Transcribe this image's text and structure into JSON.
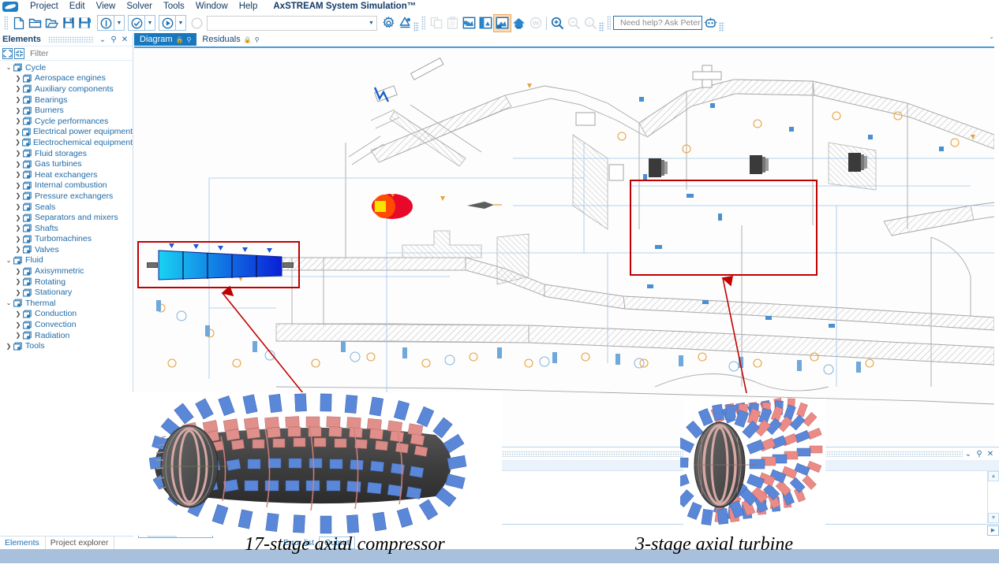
{
  "window": {
    "app_title": "AxSTREAM System Simulation™",
    "logo_icon": "axstream-logo-icon"
  },
  "menu": {
    "items": [
      "Project",
      "Edit",
      "View",
      "Solver",
      "Tools",
      "Window",
      "Help"
    ]
  },
  "toolbar": {
    "groups": [
      {
        "name": "file",
        "buttons": [
          {
            "icon": "new-document-icon",
            "label": "New",
            "state": "enabled"
          },
          {
            "icon": "open-folder-icon",
            "label": "Open",
            "state": "enabled"
          },
          {
            "icon": "open-recent-icon",
            "label": "Open recent",
            "state": "enabled"
          },
          {
            "icon": "save-icon",
            "label": "Save",
            "state": "enabled"
          },
          {
            "icon": "save-as-icon",
            "label": "Save as",
            "state": "enabled"
          }
        ]
      },
      {
        "name": "solver",
        "buttons": [
          {
            "icon": "info-circle-icon",
            "label": "Info",
            "state": "enabled",
            "split": true
          },
          {
            "icon": "check-circle-icon",
            "label": "Validate",
            "state": "enabled",
            "split": true
          },
          {
            "icon": "run-play-icon",
            "label": "Run",
            "state": "enabled",
            "split": true
          },
          {
            "icon": "stop-circle-icon",
            "label": "Stop",
            "state": "disabled"
          }
        ]
      },
      {
        "name": "settings",
        "buttons": [
          {
            "icon": "gear-settings-icon",
            "label": "Settings",
            "state": "enabled"
          },
          {
            "icon": "units-icon",
            "label": "Units",
            "state": "enabled"
          }
        ]
      },
      {
        "name": "clipboard",
        "buttons": [
          {
            "icon": "copy-icon",
            "label": "Copy",
            "state": "disabled"
          },
          {
            "icon": "paste-icon",
            "label": "Paste",
            "state": "disabled"
          },
          {
            "icon": "fit-diagram-icon",
            "label": "Fit diagram",
            "state": "enabled"
          },
          {
            "icon": "align-left-icon",
            "label": "Align",
            "state": "enabled"
          },
          {
            "icon": "background-image-icon",
            "label": "Background image",
            "state": "active"
          },
          {
            "icon": "home-view-icon",
            "label": "Home view",
            "state": "enabled"
          },
          {
            "icon": "watermark-icon",
            "label": "Watermark",
            "state": "disabled"
          }
        ]
      },
      {
        "name": "zoom",
        "buttons": [
          {
            "icon": "zoom-in-icon",
            "label": "Zoom in",
            "state": "enabled"
          },
          {
            "icon": "zoom-out-icon",
            "label": "Zoom out",
            "state": "disabled"
          },
          {
            "icon": "zoom-100-icon",
            "label": "Zoom 100%",
            "state": "disabled"
          }
        ]
      }
    ],
    "combo_value": "",
    "ask_peter": {
      "placeholder": "Need help? Ask Peter",
      "icon": "assistant-bot-icon"
    }
  },
  "elements_panel": {
    "title": "Elements",
    "header_icons": [
      "chevron-down-icon",
      "pin-icon",
      "close-icon"
    ],
    "expand_all_icon": "expand-all-icon",
    "collapse_all_icon": "collapse-all-icon",
    "filter_placeholder": "Filter",
    "search_icon": "search-icon",
    "tree": [
      {
        "label": "Cycle",
        "level": 1,
        "expanded": true
      },
      {
        "label": "Aerospace engines",
        "level": 2,
        "expanded": false
      },
      {
        "label": "Auxiliary components",
        "level": 2,
        "expanded": false
      },
      {
        "label": "Bearings",
        "level": 2,
        "expanded": false
      },
      {
        "label": "Burners",
        "level": 2,
        "expanded": false
      },
      {
        "label": "Cycle performances",
        "level": 2,
        "expanded": false
      },
      {
        "label": "Electrical power equipment",
        "level": 2,
        "expanded": false
      },
      {
        "label": "Electrochemical equipment",
        "level": 2,
        "expanded": false
      },
      {
        "label": "Fluid storages",
        "level": 2,
        "expanded": false
      },
      {
        "label": "Gas turbines",
        "level": 2,
        "expanded": false
      },
      {
        "label": "Heat exchangers",
        "level": 2,
        "expanded": false
      },
      {
        "label": "Internal combustion",
        "level": 2,
        "expanded": false
      },
      {
        "label": "Pressure exchangers",
        "level": 2,
        "expanded": false
      },
      {
        "label": "Seals",
        "level": 2,
        "expanded": false
      },
      {
        "label": "Separators and mixers",
        "level": 2,
        "expanded": false
      },
      {
        "label": "Shafts",
        "level": 2,
        "expanded": false
      },
      {
        "label": "Turbomachines",
        "level": 2,
        "expanded": false
      },
      {
        "label": "Valves",
        "level": 2,
        "expanded": false
      },
      {
        "label": "Fluid",
        "level": 1,
        "expanded": true
      },
      {
        "label": "Axisymmetric",
        "level": 2,
        "expanded": false
      },
      {
        "label": "Rotating",
        "level": 2,
        "expanded": false
      },
      {
        "label": "Stationary",
        "level": 2,
        "expanded": false
      },
      {
        "label": "Thermal",
        "level": 1,
        "expanded": true
      },
      {
        "label": "Conduction",
        "level": 2,
        "expanded": false
      },
      {
        "label": "Convection",
        "level": 2,
        "expanded": false
      },
      {
        "label": "Radiation",
        "level": 2,
        "expanded": false
      },
      {
        "label": "Tools",
        "level": 1,
        "expanded": false
      }
    ],
    "bottom_tabs": [
      {
        "label": "Elements",
        "selected": false
      },
      {
        "label": "Project explorer",
        "selected": true
      }
    ]
  },
  "document_tabs": [
    {
      "label": "Diagram",
      "selected": true,
      "lock_icon": "lock-icon",
      "pin_icon": "pin-icon"
    },
    {
      "label": "Residuals",
      "selected": false,
      "lock_icon": "lock-icon",
      "pin_icon": "pin-icon"
    }
  ],
  "canvas": {
    "background_drawing": "gas-turbine-engine-cross-section",
    "highlight_boxes": [
      {
        "name": "compressor-selection-box",
        "color": "#c00000"
      },
      {
        "name": "turbine-selection-box",
        "color": "#c00000"
      }
    ],
    "compressor_element": {
      "name": "axial-compressor-element",
      "stage_count": 5,
      "gradient_start": "#1ad0f0",
      "gradient_end": "#0a22d8"
    },
    "burner_element": {
      "name": "burner-element",
      "colors": [
        "#f5e500",
        "#e8092a"
      ]
    },
    "turbine_elements": 3,
    "annotation_arrows": [
      {
        "name": "compressor-callout-arrow",
        "color": "#c00000"
      },
      {
        "name": "turbine-callout-arrow",
        "color": "#c00000"
      }
    ]
  },
  "output_panel": {
    "header_icons": [
      "chevron-down-icon",
      "pin-icon",
      "close-icon"
    ],
    "scroll_up_icon": "scroll-up-icon",
    "scroll_down_icon": "scroll-down-icon",
    "scroll_right_icon": "scroll-right-icon",
    "tabs": [
      {
        "label": "Error list",
        "selected": false
      },
      {
        "label": "Output",
        "selected": true
      }
    ]
  },
  "callouts": [
    {
      "name": "compressor-3d-render",
      "caption": "17-stage axial compressor"
    },
    {
      "name": "turbine-3d-render",
      "caption": "3-stage axial turbine"
    }
  ],
  "colors": {
    "accent_blue": "#1878be",
    "panel_text": "#1f6ba8",
    "highlight_red": "#c00000",
    "blade_blue": "#5b87d8",
    "blade_red": "#e38a86",
    "footer": "#a9c0dd"
  }
}
